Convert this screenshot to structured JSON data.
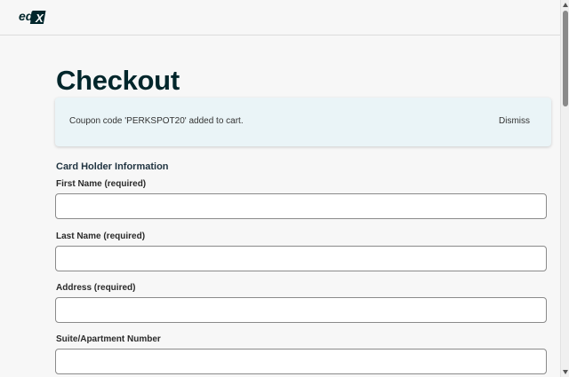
{
  "header": {
    "logo_text": "edX"
  },
  "page": {
    "title": "Checkout"
  },
  "alert": {
    "message": "Coupon code 'PERKSPOT20' added to cart.",
    "dismiss_label": "Dismiss"
  },
  "form": {
    "section_heading": "Card Holder Information",
    "fields": [
      {
        "label": "First Name (required)",
        "value": ""
      },
      {
        "label": "Last Name (required)",
        "value": ""
      },
      {
        "label": "Address (required)",
        "value": ""
      },
      {
        "label": "Suite/Apartment Number",
        "value": ""
      }
    ]
  },
  "colors": {
    "title": "#00262b",
    "alert_background": "#eaf4f7",
    "page_background": "#f7f7f7"
  }
}
